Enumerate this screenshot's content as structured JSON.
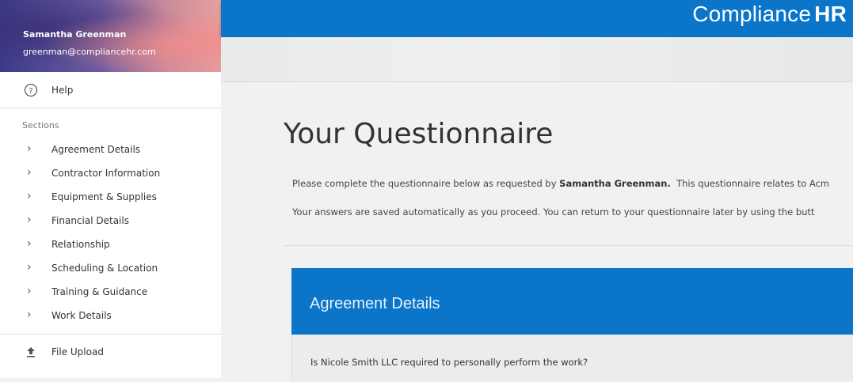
{
  "header": {
    "brand_light": "Compliance",
    "brand_bold": "HR"
  },
  "user": {
    "name": "Samantha Greenman",
    "email": "greenman@compliancehr.com"
  },
  "sidebar": {
    "help_label": "Help",
    "sections_label": "Sections",
    "sections": [
      {
        "label": "Agreement Details"
      },
      {
        "label": "Contractor Information"
      },
      {
        "label": "Equipment & Supplies"
      },
      {
        "label": "Financial Details"
      },
      {
        "label": "Relationship"
      },
      {
        "label": "Scheduling & Location"
      },
      {
        "label": "Training & Guidance"
      },
      {
        "label": "Work Details"
      }
    ],
    "upload_label": "File Upload"
  },
  "main": {
    "title": "Your Questionnaire",
    "intro1_before": "Please complete the questionnaire below as requested by ",
    "intro1_bold": "Samantha Greenman.",
    "intro1_after": "  This questionnaire relates to Acm",
    "intro2": "Your answers are saved automatically as you proceed.  You can return to your questionnaire later by using the butt",
    "card_title": "Agreement Details",
    "question": "Is Nicole Smith LLC required to personally perform the work?"
  },
  "colors": {
    "primary": "#0a75c9",
    "background": "#f1f1f1"
  },
  "icons": {
    "help": "help-circle-icon",
    "section": "chevron-right-icon",
    "upload": "upload-icon"
  }
}
